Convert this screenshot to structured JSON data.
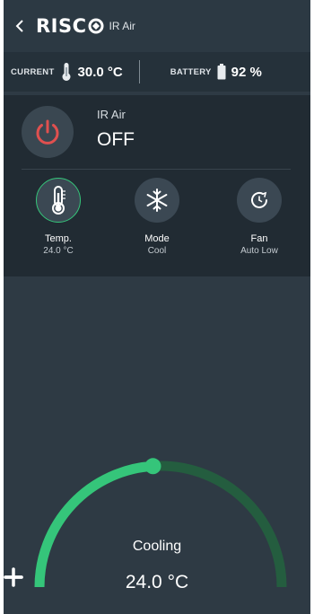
{
  "header": {
    "logo_text": "RISC",
    "device_title": "IR Air"
  },
  "status": {
    "current_label": "CURRENT",
    "current_value": "30.0 °C",
    "battery_label": "BATTERY",
    "battery_value": "92 %",
    "battery_level": 0.92
  },
  "device": {
    "name": "IR Air",
    "state": "OFF"
  },
  "controls": [
    {
      "label": "Temp.",
      "value": "24.0 °C",
      "icon": "thermometer-icon"
    },
    {
      "label": "Mode",
      "value": "Cool",
      "icon": "snowflake-icon"
    },
    {
      "label": "Fan",
      "value": "Auto Low",
      "icon": "fan-icon"
    }
  ],
  "thermostat": {
    "mode": "Cooling",
    "setpoint": "24.0 °C",
    "arc_fraction": 0.48
  },
  "colors": {
    "accent_green": "#35c57a",
    "power_red": "#e0504f",
    "background": "#2e3a44"
  }
}
